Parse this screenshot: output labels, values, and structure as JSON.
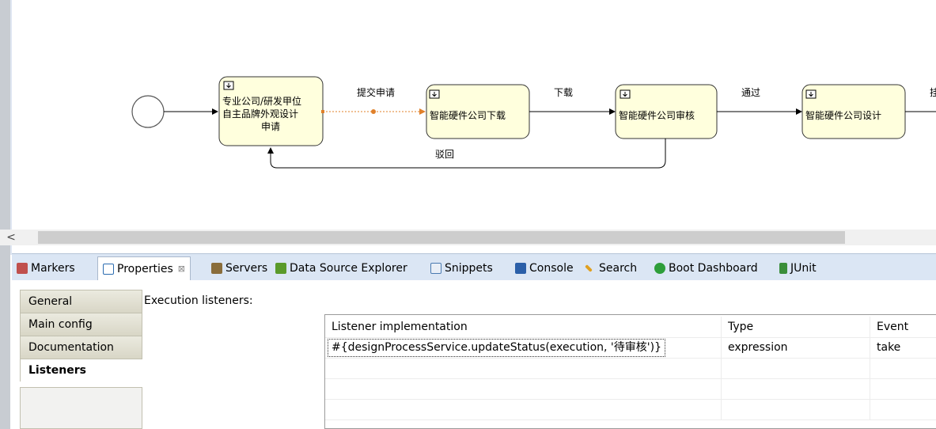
{
  "diagram": {
    "tasks": [
      {
        "id": "task1",
        "lines": [
          "专业公司/研发甲位",
          "自主品牌外观设计",
          "申请"
        ]
      },
      {
        "id": "task2",
        "lines": [
          "智能硬件公司下载"
        ]
      },
      {
        "id": "task3",
        "lines": [
          "智能硬件公司审核"
        ]
      },
      {
        "id": "task4",
        "lines": [
          "智能硬件公司设计"
        ]
      }
    ],
    "flows": {
      "submit": "提交申请",
      "download": "下载",
      "pass": "通过",
      "reject": "驳回",
      "next_partial": "挂"
    }
  },
  "scrollbar": {
    "left_arrow": "<"
  },
  "tabs": [
    {
      "label": "Markers",
      "icon": "markers-icon",
      "color": "#c0504d"
    },
    {
      "label": "Properties",
      "icon": "properties-icon",
      "color": "#2b6cb0",
      "active": true,
      "close": "⊠"
    },
    {
      "label": "Servers",
      "icon": "servers-icon",
      "color": "#8a6d3b"
    },
    {
      "label": "Data Source Explorer",
      "icon": "data-source-explorer-icon",
      "color": "#5a9a2a"
    },
    {
      "label": "Snippets",
      "icon": "snippets-icon",
      "color": "#4a7ab0"
    },
    {
      "label": "Console",
      "icon": "console-icon",
      "color": "#2b5fa8"
    },
    {
      "label": "Search",
      "icon": "search-icon",
      "color": "#e0a020"
    },
    {
      "label": "Boot Dashboard",
      "icon": "boot-dashboard-icon",
      "color": "#2e9e3a"
    },
    {
      "label": "JUnit",
      "icon": "junit-icon",
      "color": "#3a8e3a"
    }
  ],
  "side_tabs": [
    "General",
    "Main config",
    "Documentation",
    "Listeners"
  ],
  "selected_side_tab": "Listeners",
  "execution_label": "Execution listeners:",
  "table": {
    "headers": [
      "Listener implementation",
      "Type",
      "Event"
    ],
    "rows": [
      [
        "#{designProcessService.updateStatus(execution, '待审核')}",
        "expression",
        "take"
      ]
    ]
  }
}
